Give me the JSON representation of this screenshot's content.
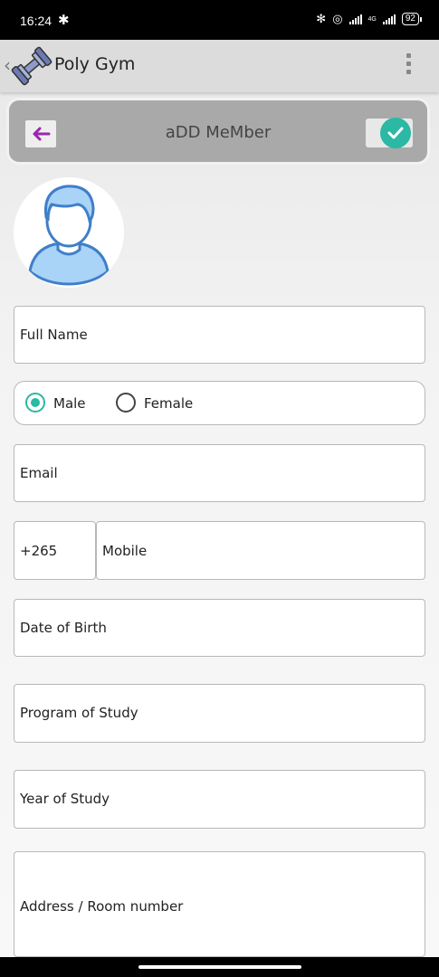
{
  "status_bar": {
    "time": "16:24",
    "network": "4G",
    "battery": "92"
  },
  "app_bar": {
    "title": "Poly Gym"
  },
  "header": {
    "title": "aDD MeMber"
  },
  "form": {
    "full_name": "Full Name",
    "gender": {
      "male": "Male",
      "female": "Female",
      "selected": "Male"
    },
    "email": "Email",
    "country_code": "+265",
    "mobile": "Mobile",
    "date_of_birth": "Date of Birth",
    "program_of_study": "Program of Study",
    "year_of_study": "Year of Study",
    "address": "Address / Room number"
  },
  "colors": {
    "accent": "#2bb8a4",
    "back_arrow": "#9b27af",
    "header_bg": "#a9a9a9",
    "app_bar_bg": "#dcdcdc"
  },
  "icons": [
    "gear-icon",
    "bluetooth-icon",
    "signal-icon",
    "battery-icon",
    "dumbbell-logo-icon",
    "overflow-menu-icon",
    "back-arrow-icon",
    "check-icon",
    "avatar-icon"
  ]
}
